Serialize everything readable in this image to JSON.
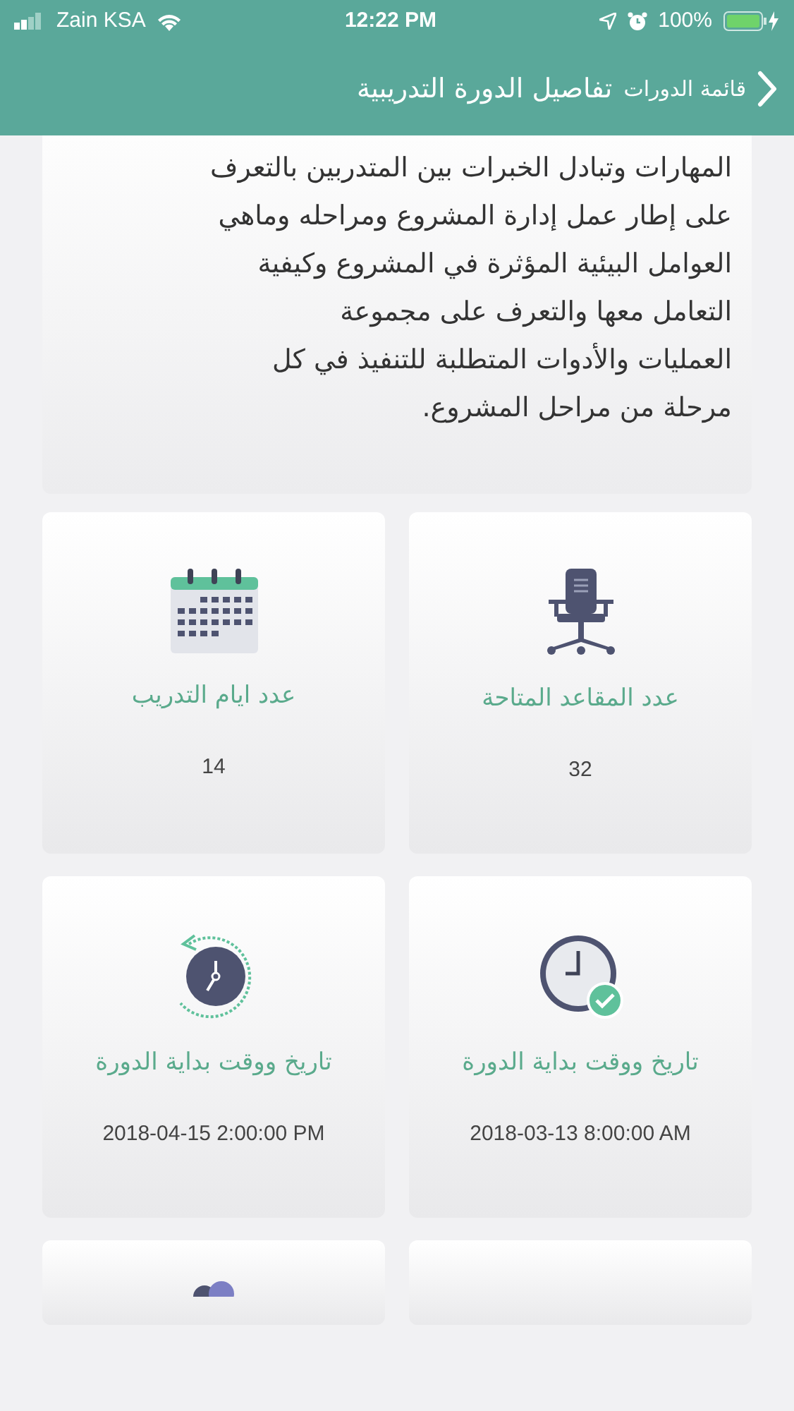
{
  "status_bar": {
    "carrier": "Zain KSA",
    "time": "12:22 PM",
    "battery": "100%"
  },
  "header": {
    "back_label": "قائمة الدورات",
    "title": "تفاصيل الدورة التدريبية"
  },
  "description": "المهارات وتبادل الخبرات بين المتدربين بالتعرف\nعلى إطار عمل إدارة المشروع ومراحله وماهي\nالعوامل البيئية المؤثرة في المشروع وكيفية\nالتعامل معها والتعرف على مجموعة\nالعمليات والأدوات المتطلبة للتنفيذ في كل\nمرحلة من مراحل المشروع.",
  "cards": [
    {
      "kind": "seats",
      "label": "عدد المقاعد المتاحة",
      "value": "32"
    },
    {
      "kind": "days",
      "label": "عدد ايام التدريب",
      "value": "14"
    },
    {
      "kind": "start",
      "label": "تاريخ ووقت بداية الدورة",
      "value": "2018-03-13  8:00:00 AM"
    },
    {
      "kind": "end",
      "label": "تاريخ ووقت بداية الدورة",
      "value": "2018-04-15 2:00:00 PM"
    }
  ]
}
